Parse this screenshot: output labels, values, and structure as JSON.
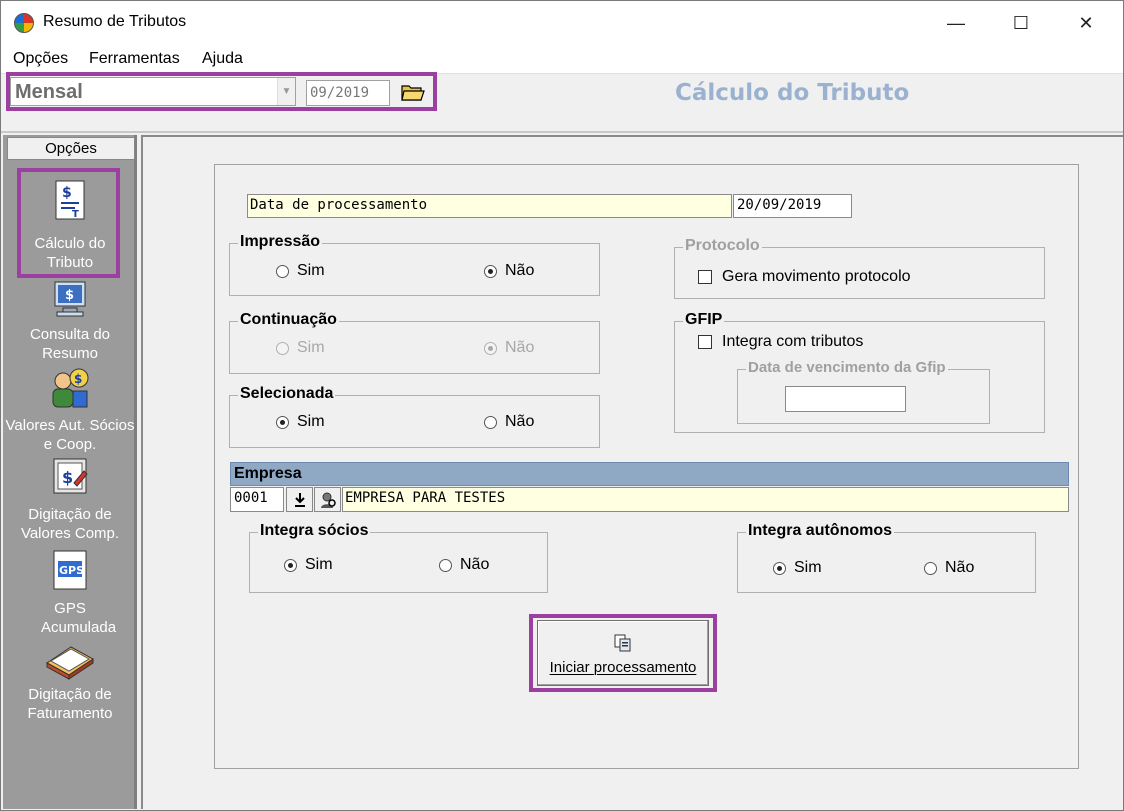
{
  "window": {
    "title": "Resumo de Tributos",
    "controls": {
      "minimize": "—",
      "maximize": "☐",
      "close": "✕"
    }
  },
  "menu": [
    "Opções",
    "Ferramentas",
    "Ajuda"
  ],
  "toolbar": {
    "period": "Mensal",
    "competence": "09/2019",
    "page_title": "Cálculo do Tributo"
  },
  "sidebar": {
    "header": "Opções",
    "items": [
      {
        "label": "Cálculo do Tributo",
        "icon": "tax-calculation-icon"
      },
      {
        "label": "Consulta do Resumo",
        "icon": "computer-money-icon"
      },
      {
        "label": "Valores Aut. Sócios e Coop.",
        "icon": "people-money-icon"
      },
      {
        "label": "Digitação de Valores Comp.",
        "icon": "money-edit-icon"
      },
      {
        "label": "GPS Acumulada",
        "icon": "gps-document-icon"
      },
      {
        "label": "Digitação de Faturamento",
        "icon": "invoice-book-icon"
      }
    ]
  },
  "form": {
    "processing_date_label": "Data de processamento",
    "processing_date": "20/09/2019",
    "impressao": {
      "label": "Impressão",
      "sim": "Sim",
      "nao": "Não",
      "selected": "nao"
    },
    "continuacao": {
      "label": "Continuação",
      "sim": "Sim",
      "nao": "Não",
      "selected": "nao",
      "enabled": false
    },
    "selecionada": {
      "label": "Selecionada",
      "sim": "Sim",
      "nao": "Não",
      "selected": "sim"
    },
    "protocolo": {
      "label": "Protocolo",
      "checkbox": "Gera movimento protocolo",
      "checked": false
    },
    "gfip": {
      "label": "GFIP",
      "checkbox": "Integra com tributos",
      "checked": false,
      "due_date_label": "Data de vencimento da Gfip",
      "due_date": ""
    },
    "empresa": {
      "label": "Empresa",
      "code": "0001",
      "name": "EMPRESA PARA TESTES"
    },
    "integra_socios": {
      "label": "Integra sócios",
      "sim": "Sim",
      "nao": "Não",
      "selected": "sim"
    },
    "integra_autonomos": {
      "label": "Integra autônomos",
      "sim": "Sim",
      "nao": "Não",
      "selected": "sim"
    },
    "start_button": "Iniciar processamento"
  },
  "colors": {
    "highlight": "#9b3fa0",
    "sidebar": "#9b9b9b",
    "title": "#9ab2cf",
    "empresa_bar": "#8fa9c5",
    "field_yellow": "#ffffe1"
  }
}
